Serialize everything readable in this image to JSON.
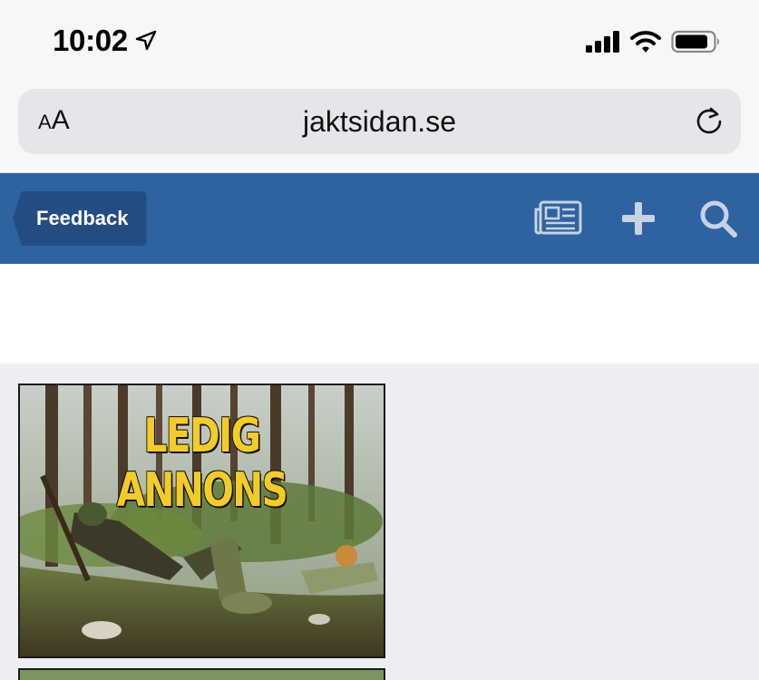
{
  "status_bar": {
    "time": "10:02",
    "icons": [
      "location-arrow-icon",
      "cellular-signal-icon",
      "wifi-icon",
      "battery-icon"
    ]
  },
  "browser": {
    "text_size_label_small": "A",
    "text_size_label_large": "A",
    "url": "jaktsidan.se",
    "icons": [
      "reload-icon"
    ]
  },
  "header": {
    "feedback_label": "Feedback",
    "icons": [
      "news-icon",
      "plus-icon",
      "search-icon"
    ],
    "background_color": "#2f62a0"
  },
  "content": {
    "ad_title": "LEDIG ANNONS",
    "background_color": "#eceef2"
  }
}
